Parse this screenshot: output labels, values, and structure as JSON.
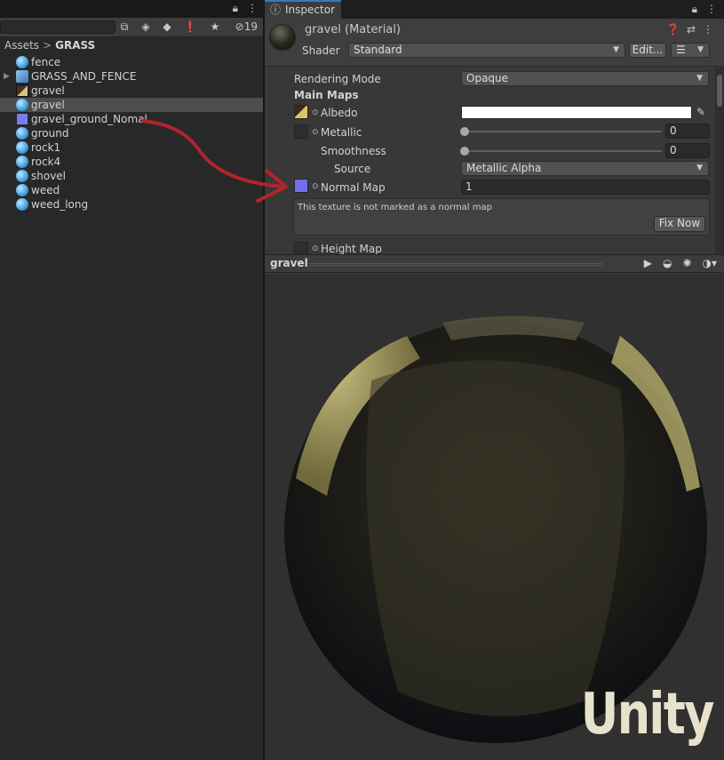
{
  "project": {
    "hidden_count": "19",
    "breadcrumb": {
      "root": "Assets",
      "separator": ">",
      "current": "GRASS"
    },
    "assets": [
      {
        "name": "fence",
        "icon": "material-icon",
        "selected": false
      },
      {
        "name": "GRASS_AND_FENCE",
        "icon": "prefab-icon",
        "selected": false,
        "expandable": true
      },
      {
        "name": "gravel",
        "icon": "texture-icon",
        "selected": false
      },
      {
        "name": "gravel",
        "icon": "material-icon",
        "selected": true
      },
      {
        "name": "gravel_ground_Nomal",
        "icon": "normal-texture-icon",
        "selected": false
      },
      {
        "name": "ground",
        "icon": "material-icon",
        "selected": false
      },
      {
        "name": "rock1",
        "icon": "material-icon",
        "selected": false
      },
      {
        "name": "rock4",
        "icon": "material-icon",
        "selected": false
      },
      {
        "name": "shovel",
        "icon": "material-icon",
        "selected": false
      },
      {
        "name": "weed",
        "icon": "material-icon",
        "selected": false
      },
      {
        "name": "weed_long",
        "icon": "material-icon",
        "selected": false
      }
    ]
  },
  "inspector": {
    "tab_label": "Inspector",
    "material_title": "gravel (Material)",
    "shader_label": "Shader",
    "shader_value": "Standard",
    "edit_button": "Edit...",
    "rendering_mode_label": "Rendering Mode",
    "rendering_mode_value": "Opaque",
    "main_maps_label": "Main Maps",
    "albedo_label": "Albedo",
    "albedo_color": "#ffffff",
    "metallic_label": "Metallic",
    "metallic_value": "0",
    "smoothness_label": "Smoothness",
    "smoothness_value": "0",
    "source_label": "Source",
    "source_value": "Metallic Alpha",
    "normal_map_label": "Normal Map",
    "normal_map_value": "1",
    "help_text": "This texture is not marked as a normal map",
    "fix_now_button": "Fix Now",
    "height_map_label": "Height Map"
  },
  "preview": {
    "title": "gravel",
    "watermark": "Unity"
  },
  "colors": {
    "accent": "#3a79bb",
    "annotation": "#b0232f"
  }
}
